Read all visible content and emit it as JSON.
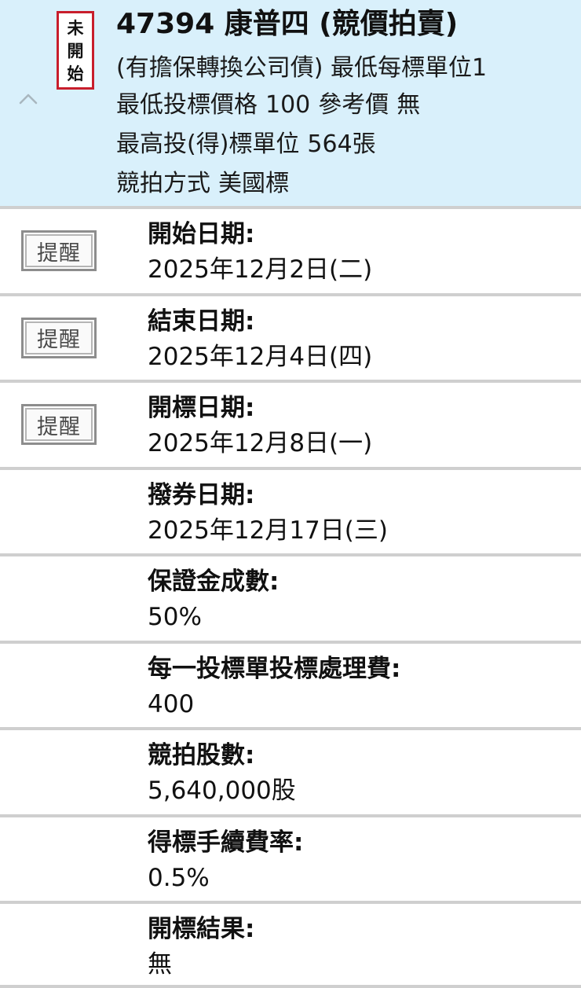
{
  "header": {
    "status_stamp": [
      "未",
      "開",
      "始"
    ],
    "collapse_icon": "chevron-up-icon",
    "title": "47394 康普四 (競價拍賣)",
    "line1": "(有擔保轉換公司債) 最低每標單位1",
    "line2": {
      "min_bid_label": "最低投標價格",
      "min_bid_value": "100",
      "ref_label": "參考價",
      "ref_value": "無"
    },
    "line3": {
      "label": "最高投(得)標單位",
      "value": "564張"
    },
    "line4": {
      "label": "競拍方式",
      "value": "美國標"
    }
  },
  "reminder_label": "提醒",
  "rows": [
    {
      "label": "開始日期:",
      "value": "2025年12月2日(二)",
      "has_reminder": true
    },
    {
      "label": "結束日期:",
      "value": "2025年12月4日(四)",
      "has_reminder": true
    },
    {
      "label": "開標日期:",
      "value": "2025年12月8日(一)",
      "has_reminder": true
    },
    {
      "label": "撥券日期:",
      "value": "2025年12月17日(三)",
      "has_reminder": false
    },
    {
      "label": "保證金成數:",
      "value": "50%",
      "has_reminder": false
    },
    {
      "label": "每一投標單投標處理費:",
      "value": "400",
      "has_reminder": false
    },
    {
      "label": "競拍股數:",
      "value": "5,640,000股",
      "has_reminder": false
    },
    {
      "label": "得標手續費率:",
      "value": "0.5%",
      "has_reminder": false
    },
    {
      "label": "開標結果:",
      "value": "無",
      "has_reminder": false
    }
  ],
  "colors": {
    "header_bg": "#d9f0fb",
    "stamp_border": "#c81e2c",
    "divider": "#cfcfcf"
  }
}
